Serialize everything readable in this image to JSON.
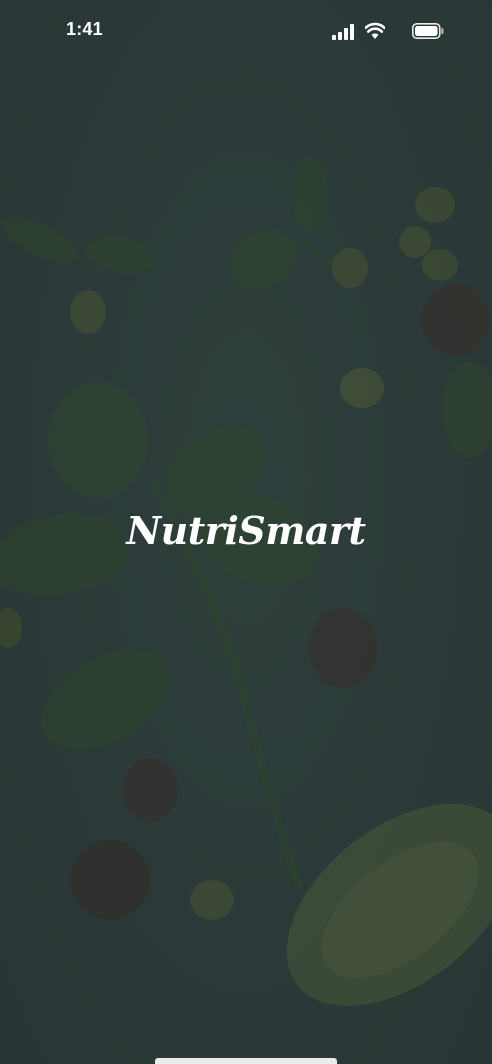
{
  "status_bar": {
    "time": "1:41",
    "icons": [
      "cellular-signal-icon",
      "wifi-icon",
      "battery-icon"
    ]
  },
  "splash": {
    "app_name": "NutriSmart"
  },
  "colors": {
    "background": "#2a3a39",
    "text": "#ffffff",
    "leaf_tint": "#34502f",
    "home_indicator": "#e9ecec"
  }
}
